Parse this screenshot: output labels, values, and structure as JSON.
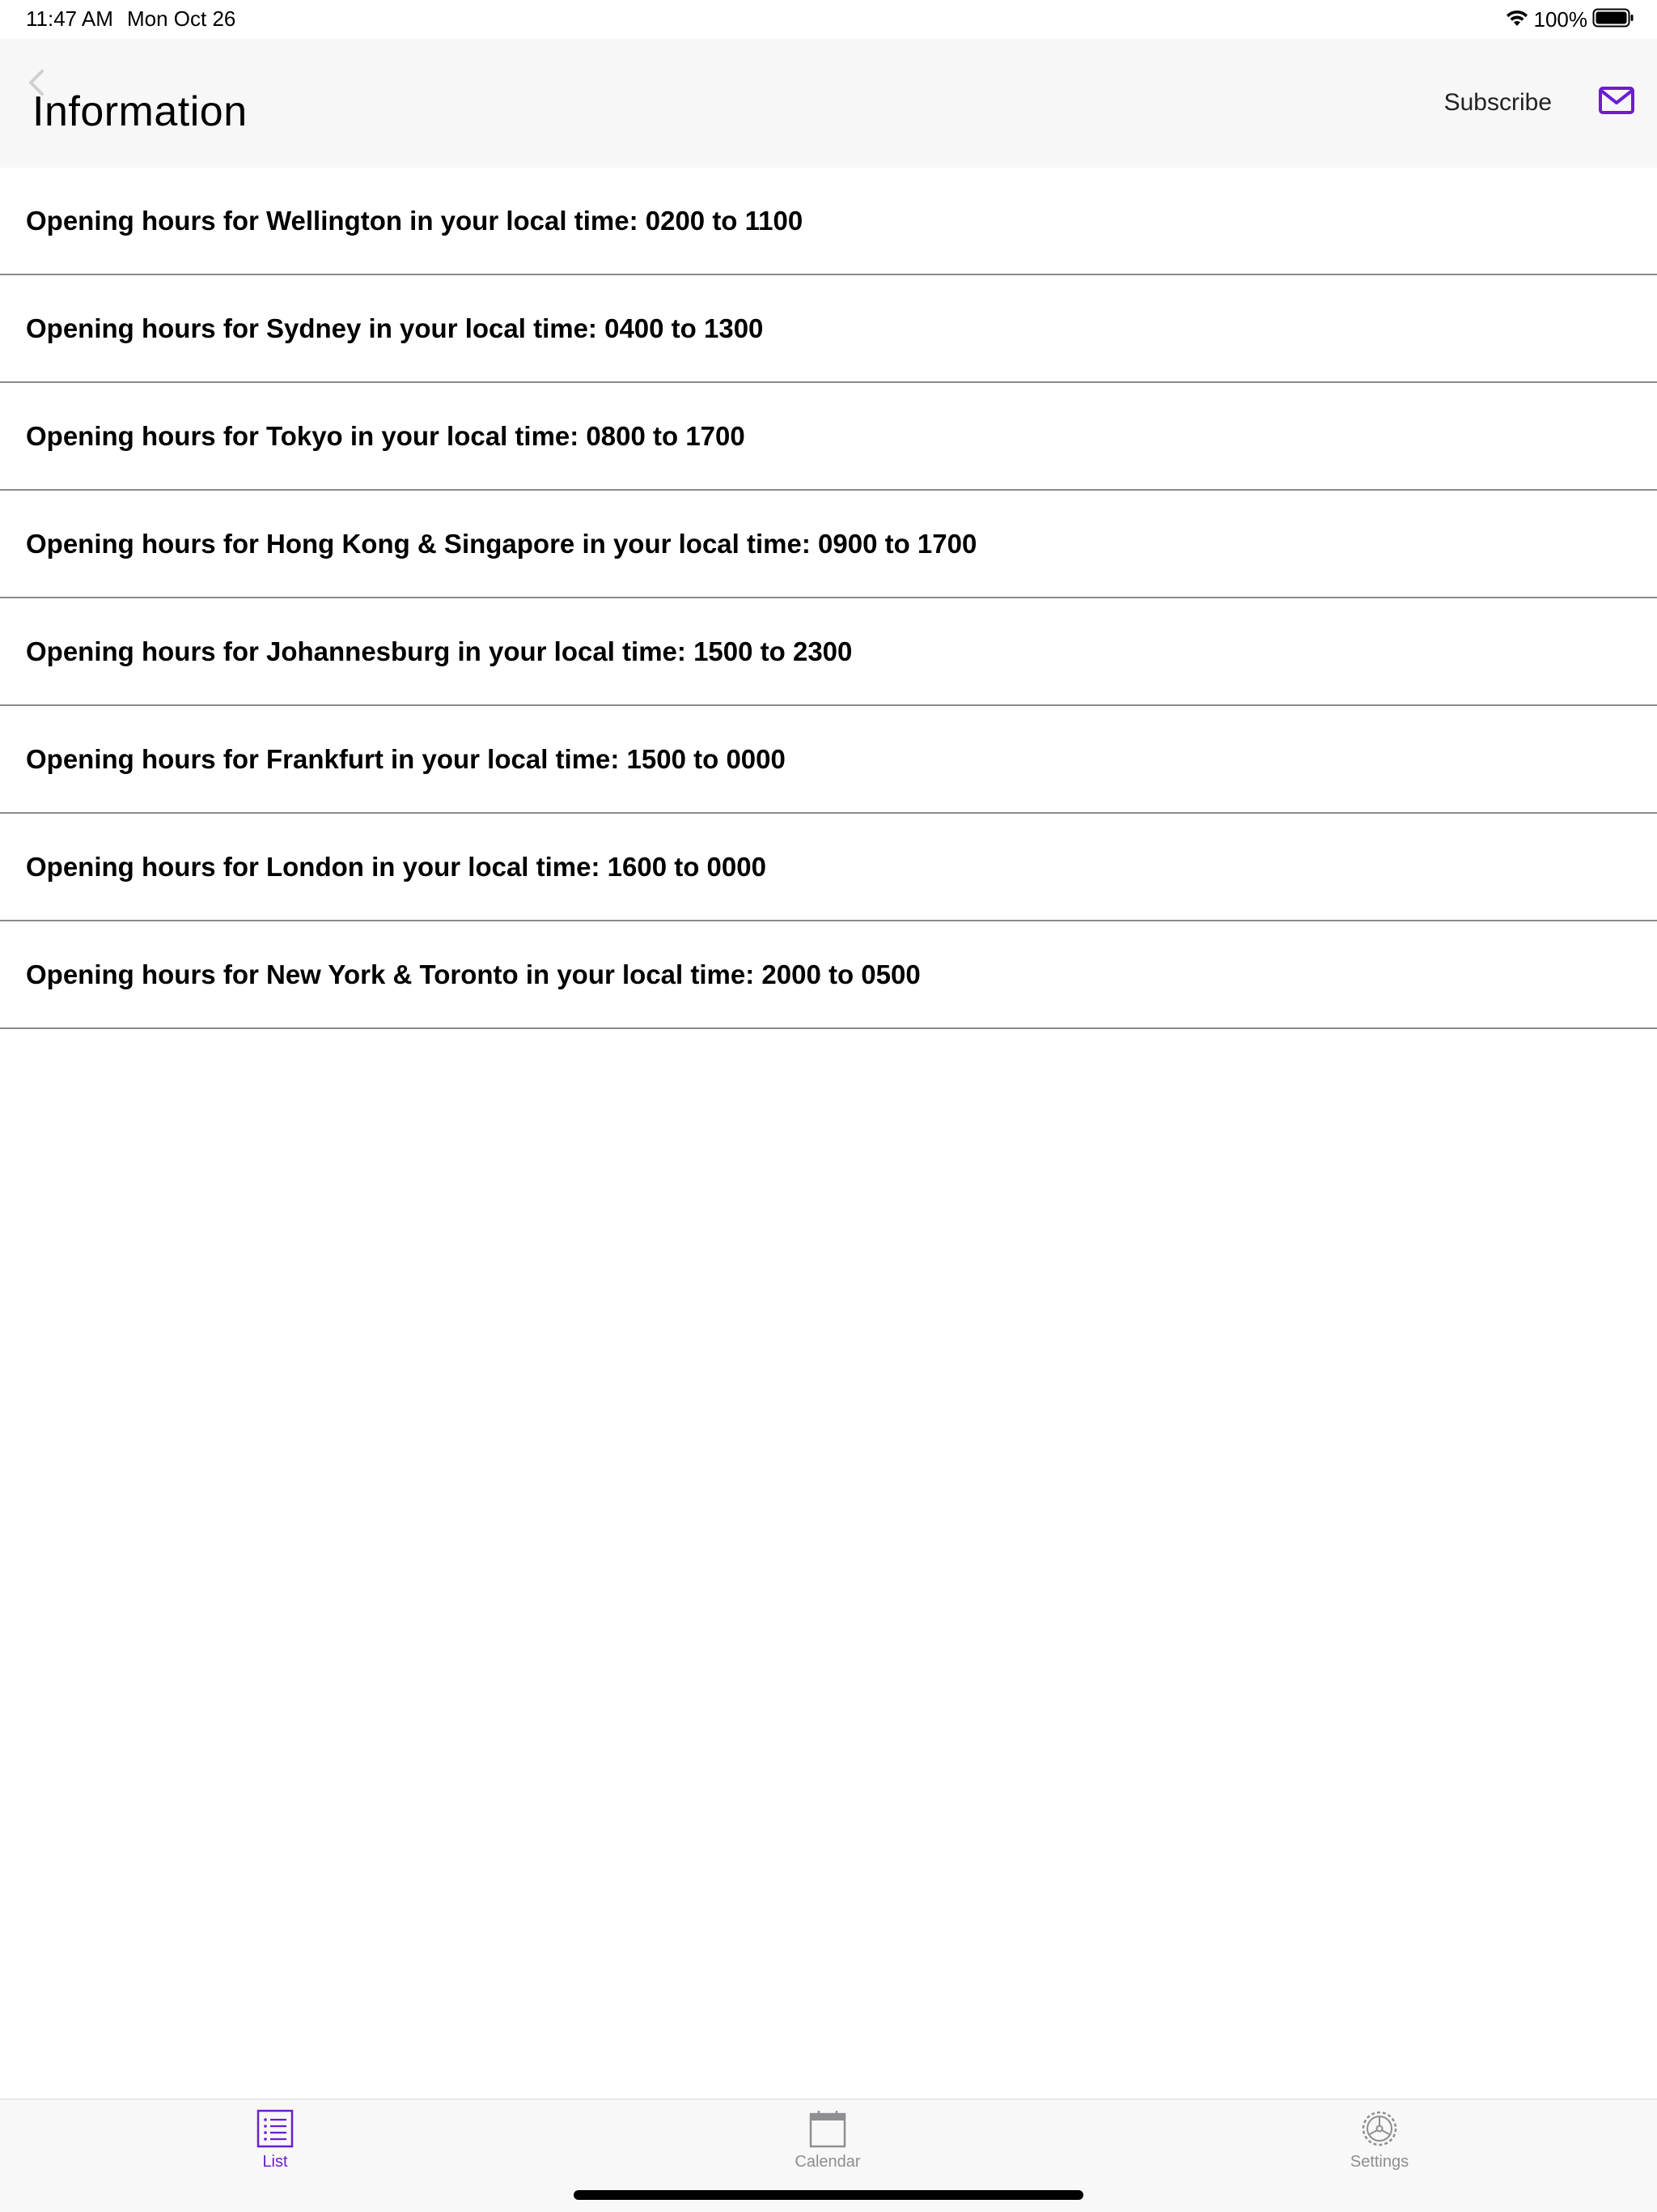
{
  "status_bar": {
    "time": "11:47 AM",
    "date": "Mon Oct 26",
    "battery_percent": "100%",
    "icons": [
      "wifi-icon",
      "battery-icon"
    ]
  },
  "nav_bar": {
    "back_icon": "chevron-left-icon",
    "title": "Information",
    "subscribe_label": "Subscribe",
    "mail_icon": "mail-icon"
  },
  "list": {
    "items": [
      {
        "label": "Opening hours for Wellington in your local time: 0200 to 1100"
      },
      {
        "label": "Opening hours for Sydney in your local time: 0400 to 1300"
      },
      {
        "label": "Opening hours for Tokyo in your local time: 0800 to 1700"
      },
      {
        "label": "Opening hours for Hong Kong & Singapore in your local time: 0900 to 1700"
      },
      {
        "label": "Opening hours for Johannesburg in your local time: 1500 to 2300"
      },
      {
        "label": "Opening hours for Frankfurt in your local time: 1500 to 0000"
      },
      {
        "label": "Opening hours for London in your local time: 1600 to 0000"
      },
      {
        "label": "Opening hours for New York & Toronto in your local time: 2000 to 0500"
      }
    ]
  },
  "tab_bar": {
    "tabs": [
      {
        "label": "List",
        "icon": "list-icon",
        "selected": true
      },
      {
        "label": "Calendar",
        "icon": "calendar-icon",
        "selected": false
      },
      {
        "label": "Settings",
        "icon": "settings-icon",
        "selected": false
      }
    ]
  },
  "colors": {
    "accent": "#6a1fd1",
    "inactive": "#8e8e93",
    "nav_background": "#f7f7f7",
    "separator": "#8a8a8a"
  }
}
